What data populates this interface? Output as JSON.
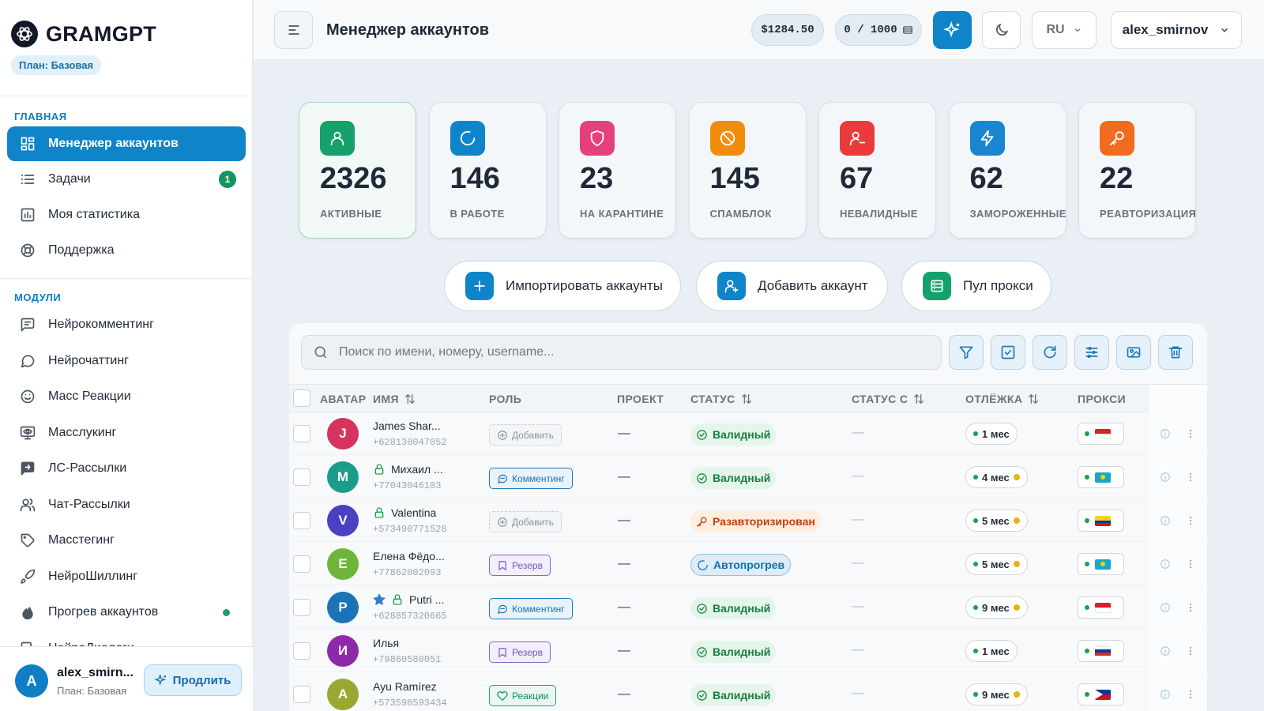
{
  "app": {
    "logo": "GRAMGPT",
    "plan_badge": "План: Базовая"
  },
  "sidebar": {
    "section_main": "ГЛАВНАЯ",
    "section_modules": "МОДУЛИ",
    "main_items": [
      {
        "label": "Менеджер аккаунтов",
        "icon": "grid-icon",
        "active": true
      },
      {
        "label": "Задачи",
        "icon": "list-icon",
        "badge": "1"
      },
      {
        "label": "Моя статистика",
        "icon": "bar-chart-icon"
      },
      {
        "label": "Поддержка",
        "icon": "lifebuoy-icon"
      }
    ],
    "module_items": [
      {
        "label": "Нейрокомментинг",
        "icon": "message-square-icon"
      },
      {
        "label": "Нейрочаттинг",
        "icon": "message-circle-icon"
      },
      {
        "label": "Масс Реакции",
        "icon": "smile-icon"
      },
      {
        "label": "Масслукинг",
        "icon": "monitor-eye-icon"
      },
      {
        "label": "ЛС-Рассылки",
        "icon": "send-message-icon"
      },
      {
        "label": "Чат-Рассылки",
        "icon": "users-icon"
      },
      {
        "label": "Масстегинг",
        "icon": "tag-icon"
      },
      {
        "label": "НейроШиллинг",
        "icon": "rocket-icon"
      },
      {
        "label": "Прогрев аккаунтов",
        "icon": "flame-icon",
        "dot": true
      },
      {
        "label": "НейроДиалоги",
        "icon": "dialog-icon"
      }
    ],
    "footer": {
      "avatar_letter": "A",
      "name": "alex_smirn...",
      "plan": "План: Базовая",
      "extend_label": "Продлить"
    }
  },
  "header": {
    "title": "Менеджер аккаунтов",
    "balance": "$1284.50",
    "quota": "0 / 1000",
    "lang": "RU",
    "user": "alex_smirnov"
  },
  "stats": [
    {
      "value": "2326",
      "label": "АКТИВНЫЕ",
      "icon": "user-icon",
      "color": "#16a06a"
    },
    {
      "value": "146",
      "label": "В РАБОТЕ",
      "icon": "spinner-icon",
      "color": "#0f84c9"
    },
    {
      "value": "23",
      "label": "НА КАРАНТИНЕ",
      "icon": "shield-icon",
      "color": "#e5407c"
    },
    {
      "value": "145",
      "label": "СПАМБЛОК",
      "icon": "ban-icon",
      "color": "#f28c0d"
    },
    {
      "value": "67",
      "label": "НЕВАЛИДНЫЕ",
      "icon": "user-minus-icon",
      "color": "#ea3a3a"
    },
    {
      "value": "62",
      "label": "ЗАМОРОЖЕННЫЕ",
      "icon": "bolt-icon",
      "color": "#1a86d1"
    },
    {
      "value": "22",
      "label": "РЕАВТОРИЗАЦИЯ",
      "icon": "key-icon",
      "color": "#f26b1f"
    }
  ],
  "actions": [
    {
      "label": "Импортировать аккаунты",
      "icon": "plus-icon",
      "color": "#0f84c9"
    },
    {
      "label": "Добавить аккаунт",
      "icon": "user-plus-icon",
      "color": "#0f84c9"
    },
    {
      "label": "Пул прокси",
      "icon": "server-list-icon",
      "color": "#16a06a"
    }
  ],
  "table": {
    "search_placeholder": "Поиск по имени, номеру, username...",
    "toolbar_icons": [
      "filter-icon",
      "check-square-icon",
      "refresh-icon",
      "sliders-icon",
      "image-icon",
      "trash-icon"
    ],
    "columns": [
      "АВАТАР",
      "ИМЯ",
      "РОЛЬ",
      "ПРОЕКТ",
      "СТАТУС",
      "СТАТУС С",
      "ОТЛЁЖКА",
      "ПРОКСИ"
    ],
    "rows": [
      {
        "letter": "J",
        "avatar_color": "#d6335f",
        "name": "James Shar...",
        "phone": "+628130047052",
        "lock": false,
        "star": false,
        "role": "Добавить",
        "role_kind": "add",
        "project": "—",
        "status": "Валидный",
        "status_kind": "valid",
        "status_since": "—",
        "rest": "1 мес",
        "rest_warn": false,
        "flag": "id"
      },
      {
        "letter": "M",
        "avatar_color": "#1b9b8a",
        "name": "Михаил ...",
        "phone": "+77043046103",
        "lock": true,
        "star": false,
        "role": "Комментинг",
        "role_kind": "comm",
        "project": "—",
        "status": "Валидный",
        "status_kind": "valid",
        "status_since": "—",
        "rest": "4 мес",
        "rest_warn": true,
        "flag": "kz"
      },
      {
        "letter": "V",
        "avatar_color": "#4b3fc4",
        "name": "Valentina",
        "phone": "+573490771528",
        "lock": true,
        "star": false,
        "role": "Добавить",
        "role_kind": "add",
        "project": "—",
        "status": "Разавторизирован",
        "status_kind": "deauth",
        "status_since": "—",
        "rest": "5 мес",
        "rest_warn": true,
        "flag": "co"
      },
      {
        "letter": "E",
        "avatar_color": "#6fb53a",
        "name": "Елена Фёдо...",
        "phone": "+77862002093",
        "lock": false,
        "star": false,
        "role": "Резерв",
        "role_kind": "res",
        "project": "—",
        "status": "Автопрогрев",
        "status_kind": "warm",
        "status_since": "—",
        "rest": "5 мес",
        "rest_warn": true,
        "flag": "kz"
      },
      {
        "letter": "P",
        "avatar_color": "#1d73b8",
        "name": "Putri ...",
        "phone": "+628857320665",
        "lock": true,
        "star": true,
        "role": "Комментинг",
        "role_kind": "comm",
        "project": "—",
        "status": "Валидный",
        "status_kind": "valid",
        "status_since": "—",
        "rest": "9 мес",
        "rest_warn": true,
        "flag": "id"
      },
      {
        "letter": "И",
        "avatar_color": "#8e2aa8",
        "name": "Илья",
        "phone": "+79860580051",
        "lock": false,
        "star": false,
        "role": "Резерв",
        "role_kind": "res",
        "project": "—",
        "status": "Валидный",
        "status_kind": "valid",
        "status_since": "—",
        "rest": "1 мес",
        "rest_warn": false,
        "flag": "ru"
      },
      {
        "letter": "A",
        "avatar_color": "#9aa832",
        "name": "Ayu Ramírez",
        "phone": "+573590593434",
        "lock": false,
        "star": false,
        "role": "Реакции",
        "role_kind": "react",
        "project": "—",
        "status": "Валидный",
        "status_kind": "valid",
        "status_since": "—",
        "rest": "9 мес",
        "rest_warn": true,
        "flag": "ph"
      }
    ]
  }
}
